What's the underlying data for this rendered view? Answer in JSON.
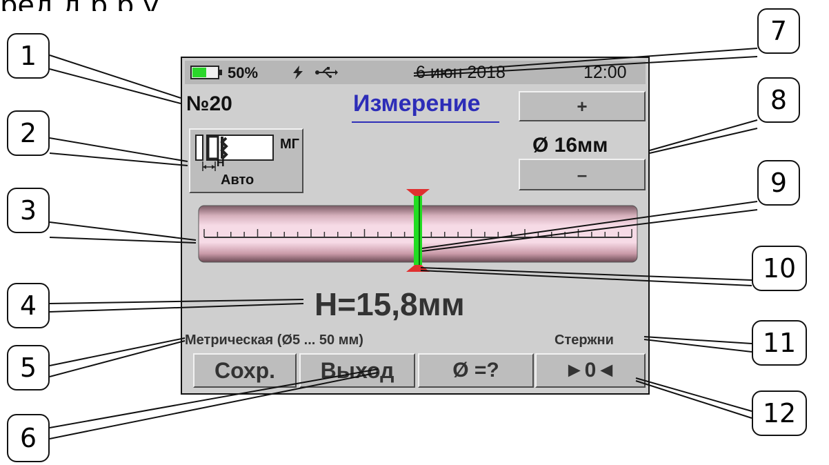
{
  "top_cut_text": "ред                                               д    р   р у",
  "status": {
    "battery": "50%",
    "datetime_date": "6 июн 2018",
    "datetime_time": "12:00"
  },
  "header": {
    "number": "№20",
    "mode_title": "Измерение"
  },
  "diameter": {
    "plus_label": "+",
    "value": "Ø 16мм",
    "minus_label": "–"
  },
  "sensor_mode": {
    "unit_label": "МГ",
    "h_label": "Н",
    "auto_label": "Авто"
  },
  "result": {
    "depth_text": "Н=15,8мм"
  },
  "info": {
    "rebar_range": "Метрическая (Ø5 ... 50 мм)",
    "object_type": "Стержни"
  },
  "softkeys": [
    {
      "label": "Сохр."
    },
    {
      "label": "Выход"
    },
    {
      "label": "Ø =?"
    },
    {
      "label": "►0◄"
    }
  ],
  "callouts": [
    "1",
    "2",
    "3",
    "4",
    "5",
    "6",
    "7",
    "8",
    "9",
    "10",
    "11",
    "12"
  ],
  "indicator": {
    "position_fraction": 0.5
  },
  "colors": {
    "accent_title": "#2d2db8",
    "indicator_green": "#22dd22",
    "indicator_red": "#e03030",
    "scale_pink": "#f6dbe6"
  }
}
